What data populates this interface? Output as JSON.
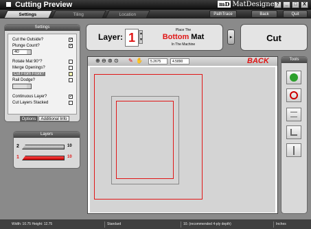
{
  "app": {
    "title": "Cutting Preview",
    "brand": "MatDesigner",
    "brand_mark": "mD",
    "window_buttons": [
      "?",
      "_",
      "□",
      "X"
    ]
  },
  "tabs": [
    {
      "label": "Settings",
      "active": true
    },
    {
      "label": "Tiling",
      "active": false
    },
    {
      "label": "Location",
      "active": false
    }
  ],
  "toolbar": {
    "path_trace": "PathTrace",
    "back": "Back",
    "quit": "Quit"
  },
  "settings": {
    "title": "Settings",
    "options": [
      {
        "label": "Cut the Outside?",
        "checked": true
      },
      {
        "label": "Plunge Count?",
        "checked": true
      },
      {
        "label": "Rotate Mat 90°?",
        "checked": false
      },
      {
        "label": "Merge Openings?",
        "checked": false
      },
      {
        "label": "Cut From Front?",
        "checked": false
      },
      {
        "label": "Rail Dodge?",
        "checked": false
      },
      {
        "label": "Continuous Layer?",
        "checked": true
      },
      {
        "label": "Cut Layers Stacked",
        "checked": false
      }
    ],
    "plunge_value": "40",
    "subtabs": [
      "Options",
      "Additional Info"
    ]
  },
  "layers_panel": {
    "title": "Layers",
    "rows": [
      {
        "number": "2",
        "count": "10",
        "color": "#a8a8a8"
      },
      {
        "number": "1",
        "count": "10",
        "color": "#e01515"
      }
    ]
  },
  "layer_box": {
    "label": "Layer:",
    "value": "1",
    "place_top": "Place The",
    "bottom": "Bottom",
    "mat": "Mat",
    "place_bottom": "In The Machine"
  },
  "cut_label": "Cut",
  "canvas": {
    "coord_x": "5.2675",
    "coord_y": "4.5890",
    "back_label": "BACK",
    "icons": [
      "zoom-in-icon",
      "zoom-out-icon",
      "zoom-fit-icon",
      "zoom-window-icon",
      "knife-icon",
      "pan-icon"
    ]
  },
  "tools": {
    "title": "Tools",
    "items": [
      "green-arrow-icon",
      "no-icon",
      "list-icon",
      "corner-icon",
      "split-icon"
    ]
  },
  "status": {
    "size": "Width: 10.75  Height: 12.75",
    "mode": "Standard",
    "blade": "10. (recommended 4-ply depth)",
    "units": "Inches"
  },
  "colors": {
    "accent_red": "#e01515",
    "title_bg": "#1a1a1a",
    "panel_bg": "#d9d9d9"
  }
}
